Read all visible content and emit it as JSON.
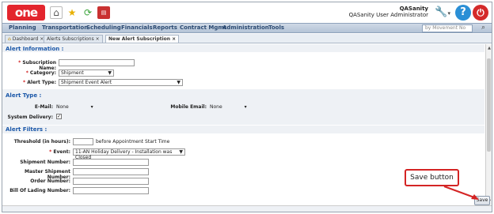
{
  "app": {
    "logo_text": "one"
  },
  "quick_icons": [
    "home-icon",
    "star-icon",
    "refresh-icon",
    "pdf-icon"
  ],
  "user": {
    "name": "QASanity",
    "role": "QASanity User Administrator"
  },
  "nav": {
    "items": [
      "Planning",
      "Transportation",
      "Scheduling",
      "Financials",
      "Reports",
      "Contract Mgmt",
      "Administration",
      "Tools"
    ],
    "search_placeholder": "by Movement No"
  },
  "tabs": [
    {
      "label": "Dashboard"
    },
    {
      "label": "Alerts Subscriptions"
    },
    {
      "label": "New Alert Subscription"
    }
  ],
  "alert_info": {
    "heading": "Alert Information :",
    "subscription_name_label": "Subscription Name:",
    "subscription_name_value": "",
    "category_label": "Category:",
    "category_value": "Shipment",
    "alert_type_label": "Alert Type:",
    "alert_type_value": "Shipment Event Alert"
  },
  "alert_type": {
    "heading": "Alert Type :",
    "email_label": "E-Mail:",
    "email_value": "None",
    "mobile_label": "Mobile Email:",
    "mobile_value": "None",
    "system_delivery_label": "System Delivery:",
    "system_delivery_checked": true
  },
  "alert_filters": {
    "heading": "Alert Filters :",
    "threshold_label": "Threshold (in hours):",
    "threshold_value": "",
    "threshold_suffix": "before Appointment Start Time",
    "event_label": "Event:",
    "event_value": "11-AN Holiday Delivery - Installation was Closed",
    "shipment_number_label": "Shipment Number:",
    "master_shipment_label": "Master Shipment Number:",
    "order_number_label": "Order Number:",
    "bol_label": "Bill Of Lading Number:"
  },
  "footer": {
    "save_label": "Save"
  },
  "callout": {
    "text": "Save button"
  },
  "colors": {
    "accent": "#1a57a8",
    "callout_border": "#d42424",
    "logo": "#e3252d"
  }
}
